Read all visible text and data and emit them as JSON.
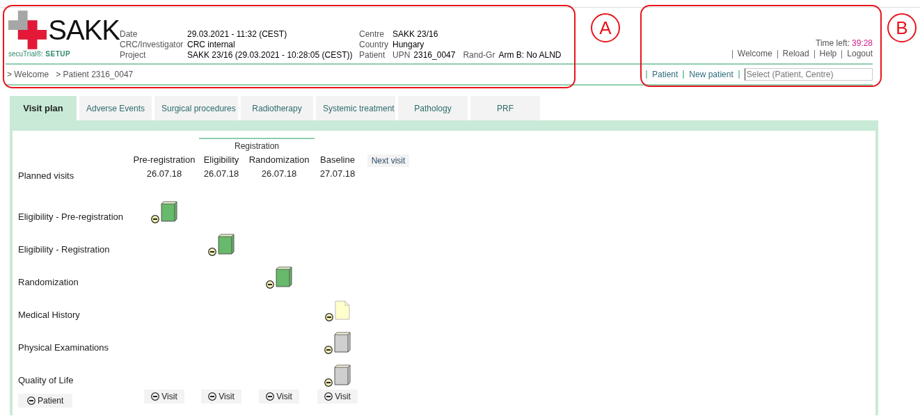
{
  "header": {
    "logo": {
      "wordmark": "SAKK",
      "product": "secuTrial®:",
      "edition": "SETUP"
    },
    "info_left": [
      {
        "label": "Date",
        "value": "29.03.2021 - 11:32 (CEST)"
      },
      {
        "label": "CRC/Investigator",
        "value": "CRC internal"
      },
      {
        "label": "Project",
        "value": "SAKK 23/16 (29.03.2021 - 10:28:05 (CEST))"
      }
    ],
    "info_right": [
      {
        "label": "Centre",
        "value": "SAKK 23/16"
      },
      {
        "label": "Country",
        "value": "Hungary"
      },
      {
        "label": "Patient",
        "extra": [
          {
            "label": "UPN",
            "value": "2316_0047"
          },
          {
            "label": "Rand-Gr",
            "value": "Arm B: No ALND"
          }
        ]
      }
    ],
    "breadcrumb": [
      "> Welcome",
      "> Patient 2316_0047"
    ],
    "time_left_label": "Time left:",
    "time_left": "39:28",
    "links": [
      "Welcome",
      "Reload",
      "Help",
      "Logout"
    ],
    "nav_links": [
      "Patient",
      "New patient"
    ],
    "search": {
      "placeholder": "Select (Patient, Centre)"
    }
  },
  "tabs": [
    {
      "label": "Visit plan",
      "selected": true
    },
    {
      "label": "Adverse Events",
      "selected": false
    },
    {
      "label": "Surgical procedures",
      "selected": false
    },
    {
      "label": "Radiotherapy",
      "selected": false
    },
    {
      "label": "Systemic treatment",
      "selected": false
    },
    {
      "label": "Pathology",
      "selected": false
    },
    {
      "label": "PRF",
      "selected": false
    }
  ],
  "visit_plan": {
    "group_label": "Registration",
    "planned_label": "Planned visits",
    "next_visit": "Next visit",
    "visits": [
      {
        "name": "Pre-registration",
        "date": "26.07.18"
      },
      {
        "name": "Eligibility",
        "date": "26.07.18"
      },
      {
        "name": "Randomization",
        "date": "26.07.18"
      },
      {
        "name": "Baseline",
        "date": "27.07.18"
      }
    ],
    "forms": [
      {
        "name": "Eligibility - Pre-registration",
        "cells": [
          {
            "kind": "book",
            "color": "#67b96b"
          },
          {
            "kind": "none"
          },
          {
            "kind": "none"
          },
          {
            "kind": "none"
          }
        ]
      },
      {
        "name": "Eligibility - Registration",
        "cells": [
          {
            "kind": "none"
          },
          {
            "kind": "book",
            "color": "#67b96b"
          },
          {
            "kind": "none"
          },
          {
            "kind": "none"
          }
        ]
      },
      {
        "name": "Randomization",
        "cells": [
          {
            "kind": "none"
          },
          {
            "kind": "none"
          },
          {
            "kind": "book",
            "color": "#67b96b"
          },
          {
            "kind": "none"
          }
        ]
      },
      {
        "name": "Medical History",
        "cells": [
          {
            "kind": "none"
          },
          {
            "kind": "none"
          },
          {
            "kind": "none"
          },
          {
            "kind": "page",
            "color": "#ffffcc"
          }
        ]
      },
      {
        "name": "Physical Examinations",
        "cells": [
          {
            "kind": "none"
          },
          {
            "kind": "none"
          },
          {
            "kind": "none"
          },
          {
            "kind": "book",
            "color": "#cfcfcf"
          }
        ]
      },
      {
        "name": "Quality of Life",
        "cells": [
          {
            "kind": "none"
          },
          {
            "kind": "none"
          },
          {
            "kind": "none"
          },
          {
            "kind": "book",
            "color": "#cfcfcf"
          }
        ]
      }
    ],
    "patient_button": "Patient",
    "visit_buttons": [
      "Visit",
      "Visit",
      "Visit",
      "Visit"
    ]
  },
  "annotations": [
    {
      "label": "A"
    },
    {
      "label": "B"
    }
  ]
}
